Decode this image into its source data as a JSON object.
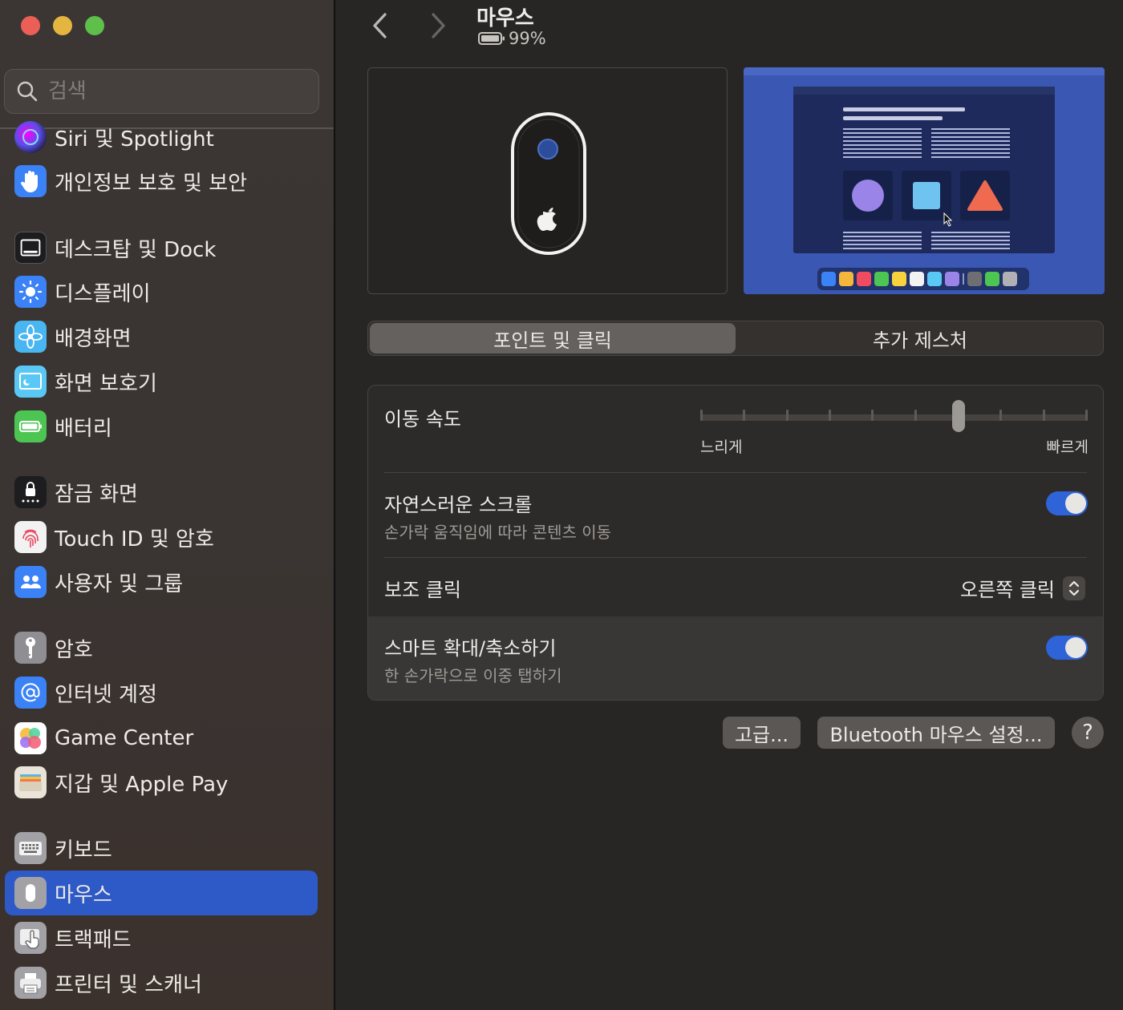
{
  "window": {
    "title": "마우스",
    "battery_percent": "99%"
  },
  "search": {
    "placeholder": "검색"
  },
  "sidebar": {
    "items": [
      {
        "label": "Siri 및 Spotlight",
        "icon": "siri-icon"
      },
      {
        "label": "개인정보 보호 및 보안",
        "icon": "hand-icon"
      },
      {
        "label": "데스크탑 및 Dock",
        "icon": "dock-icon"
      },
      {
        "label": "디스플레이",
        "icon": "sun-icon"
      },
      {
        "label": "배경화면",
        "icon": "flower-icon"
      },
      {
        "label": "화면 보호기",
        "icon": "screensaver-icon"
      },
      {
        "label": "배터리",
        "icon": "battery-icon"
      },
      {
        "label": "잠금 화면",
        "icon": "lock-icon"
      },
      {
        "label": "Touch ID 및 암호",
        "icon": "fingerprint-icon"
      },
      {
        "label": "사용자 및 그룹",
        "icon": "users-icon"
      },
      {
        "label": "암호",
        "icon": "key-icon"
      },
      {
        "label": "인터넷 계정",
        "icon": "at-icon"
      },
      {
        "label": "Game Center",
        "icon": "game-center-icon"
      },
      {
        "label": "지갑 및 Apple Pay",
        "icon": "wallet-icon"
      },
      {
        "label": "키보드",
        "icon": "keyboard-icon"
      },
      {
        "label": "마우스",
        "icon": "mouse-icon",
        "selected": true
      },
      {
        "label": "트랙패드",
        "icon": "trackpad-icon"
      },
      {
        "label": "프린터 및 스캐너",
        "icon": "printer-icon"
      }
    ]
  },
  "tabs": [
    {
      "label": "포인트 및 클릭",
      "active": true
    },
    {
      "label": "추가 제스처",
      "active": false
    }
  ],
  "settings": {
    "tracking_speed": {
      "title": "이동 속도",
      "min_label": "느리게",
      "max_label": "빠르게",
      "ticks": 10,
      "value_index": 6
    },
    "natural_scroll": {
      "title": "자연스러운 스크롤",
      "subtitle": "손가락 움직임에 따라 콘텐츠 이동",
      "on": true
    },
    "secondary_click": {
      "title": "보조 클릭",
      "value": "오른쪽 클릭"
    },
    "smart_zoom": {
      "title": "스마트 확대/축소하기",
      "subtitle": "한 손가락으로 이중 탭하기",
      "on": true
    }
  },
  "buttons": {
    "advanced": "고급...",
    "bluetooth": "Bluetooth 마우스 설정...",
    "help": "?"
  },
  "colors": {
    "accent": "#2d5ac7",
    "toggle_on": "#2f63d8"
  }
}
